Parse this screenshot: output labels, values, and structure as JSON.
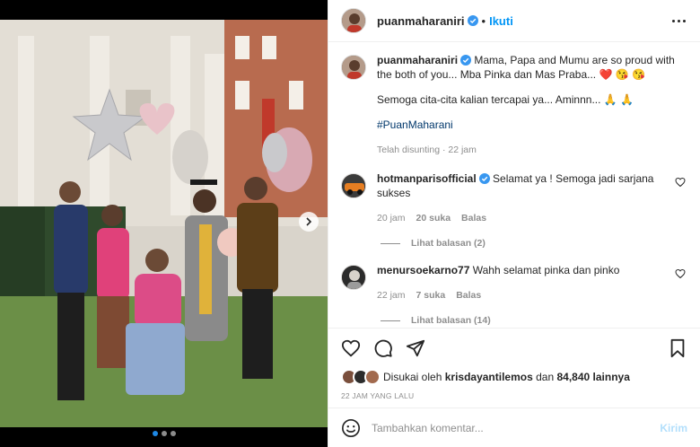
{
  "post": {
    "author": "puanmaharaniri",
    "separator": "•",
    "follow_label": "Ikuti",
    "more_icon": "more-horizontal-icon",
    "caption": {
      "text_line1": "Mama, Papa and Mumu are so proud with the both of you... Mba Pinka dan Mas Praba... ❤️ 😘 😘",
      "text_line2": "Semoga cita-cita kalian tercapai ya... Aminnn... 🙏 🙏",
      "hashtag": "#PuanMaharani",
      "edited": "Telah disunting · 22 jam"
    }
  },
  "comments": [
    {
      "user": "hotmanparisofficial",
      "verified": true,
      "text": "Selamat ya ! Semoga jadi sarjana sukses",
      "time": "20 jam",
      "likes": "20 suka",
      "reply_label": "Balas",
      "view_replies": "Lihat balasan (2)"
    },
    {
      "user": "menursoekarno77",
      "verified": false,
      "text": "Wahh selamat pinka dan pinko",
      "time": "22 jam",
      "likes": "7 suka",
      "reply_label": "Balas",
      "view_replies": "Lihat balasan (14)"
    }
  ],
  "actions": {
    "like_icon": "heart-icon",
    "comment_icon": "comment-icon",
    "share_icon": "send-icon",
    "save_icon": "bookmark-icon"
  },
  "likes": {
    "prefix": "Disukai oleh",
    "user": "krisdayantilemos",
    "middle": "dan",
    "count": "84,840 lainnya"
  },
  "timestamp": "22 JAM YANG LALU",
  "composer": {
    "emoji_icon": "emoji-icon",
    "placeholder": "Tambahkan komentar...",
    "post_label": "Kirim"
  },
  "media": {
    "carousel_position": 1,
    "carousel_count": 3
  },
  "colors": {
    "accent": "#0095f6",
    "verified": "#3897f0",
    "hashtag": "#00376b",
    "muted": "#8e8e8e",
    "like_red": "#ed4956"
  }
}
